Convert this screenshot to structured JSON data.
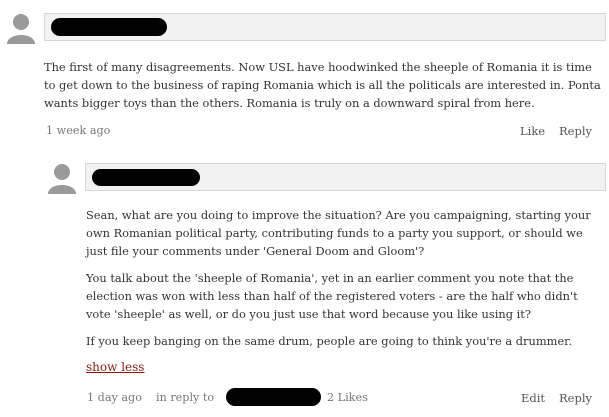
{
  "comments": [
    {
      "body": [
        "The first of many disagreements. Now USL  have hoodwinked the sheeple of Romania it is time to get down to the business of raping Romania which is all the politicals are interested in. Ponta wants bigger toys than the others.  Romania is truly on a downward spiral from here."
      ],
      "timestamp": "1 week ago",
      "actions": {
        "like": "Like",
        "reply": "Reply"
      }
    },
    {
      "body": [
        "Sean, what are you doing to improve the situation? Are you campaigning, starting your own Romanian political party, contributing funds to a party you support, or should we just file your comments under 'General Doom and Gloom'?",
        "You talk about the 'sheeple of Romania', yet in an earlier comment you note that the election was won with less than half of the registered voters - are the half who didn't vote 'sheeple' as well, or do you just use that word because you like using it?",
        "If you keep banging on the same drum, people are going to think you're a drummer."
      ],
      "show_less": "show less",
      "timestamp": "1 day ago",
      "in_reply_to": "in reply to",
      "likes": "2 Likes",
      "actions": {
        "edit": "Edit",
        "reply": "Reply"
      }
    }
  ],
  "icons": {
    "avatar": "default-user-avatar-icon"
  }
}
